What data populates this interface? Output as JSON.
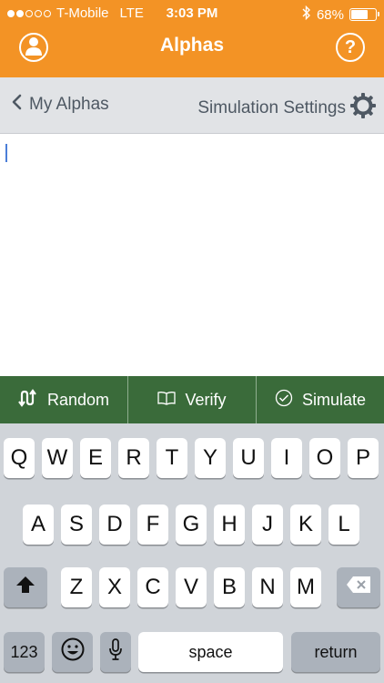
{
  "status": {
    "carrier": "T-Mobile",
    "network": "LTE",
    "time": "3:03 PM",
    "battery": "68%",
    "battery_level": 0.68,
    "signal_bars": 2
  },
  "nav": {
    "title": "Alphas",
    "help_label": "?"
  },
  "subheader": {
    "back_label": "My Alphas",
    "settings_label": "Simulation Settings"
  },
  "editor": {
    "value": ""
  },
  "actions": [
    {
      "label": "Random",
      "icon": "random-arrows-icon"
    },
    {
      "label": "Verify",
      "icon": "book-icon"
    },
    {
      "label": "Simulate",
      "icon": "check-circle-icon"
    }
  ],
  "keyboard": {
    "row1": [
      "Q",
      "W",
      "E",
      "R",
      "T",
      "Y",
      "U",
      "I",
      "O",
      "P"
    ],
    "row2": [
      "A",
      "S",
      "D",
      "F",
      "G",
      "H",
      "J",
      "K",
      "L"
    ],
    "row3": [
      "Z",
      "X",
      "C",
      "V",
      "B",
      "N",
      "M"
    ],
    "numbers_label": "123",
    "space_label": "space",
    "return_label": "return"
  },
  "colors": {
    "accent": "#f39325",
    "action_bar": "#3a6b3a",
    "subheader_bg": "#e1e3e6",
    "caret": "#4b7ed8"
  }
}
